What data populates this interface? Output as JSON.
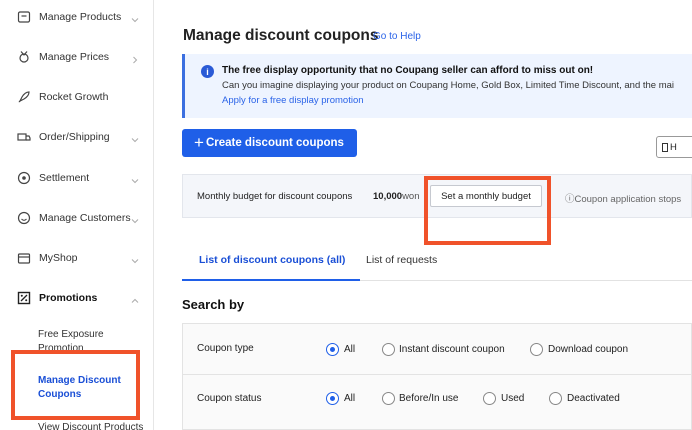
{
  "sidebar": {
    "items": [
      {
        "label": "Manage Products",
        "icon": "box-icon"
      },
      {
        "label": "Manage Prices",
        "icon": "price-tag-icon"
      },
      {
        "label": "Rocket Growth",
        "icon": "rocket-icon"
      },
      {
        "label": "Order/Shipping",
        "icon": "truck-icon"
      },
      {
        "label": "Settlement",
        "icon": "coin-icon"
      },
      {
        "label": "Manage Customers",
        "icon": "smile-icon"
      },
      {
        "label": "MyShop",
        "icon": "shop-icon"
      },
      {
        "label": "Promotions",
        "icon": "promotion-icon"
      }
    ],
    "sub_items": [
      "Free Exposure Promotion",
      "Manage Discount Coupons",
      "View Discount Products"
    ]
  },
  "main": {
    "title": "Manage discount coupons",
    "help_link": "Go to Help",
    "notice": {
      "title": "The free display opportunity that no Coupang seller can afford to miss out on!",
      "body": "Can you imagine displaying your product on Coupang Home, Gold Box, Limited Time Discount, and the mai",
      "link": "Apply for a free display promotion"
    },
    "create_button": "Create discount coupons",
    "right_button": "H",
    "budget": {
      "label": "Monthly budget for discount coupons",
      "amount": "10,000",
      "unit": "won",
      "button": "Set a monthly budget",
      "note": "ⓘCoupon application stops"
    },
    "tabs": [
      "List of discount coupons (all)",
      "List of requests"
    ],
    "search_title": "Search by",
    "filters": {
      "coupon_type": {
        "label": "Coupon type",
        "options": [
          "All",
          "Instant discount coupon",
          "Download coupon"
        ],
        "selected": "All"
      },
      "coupon_status": {
        "label": "Coupon status",
        "options": [
          "All",
          "Before/In use",
          "Used",
          "Deactivated"
        ],
        "selected": "All"
      }
    }
  },
  "colors": {
    "accent": "#1f5fe8",
    "highlight": "#f0522a"
  }
}
